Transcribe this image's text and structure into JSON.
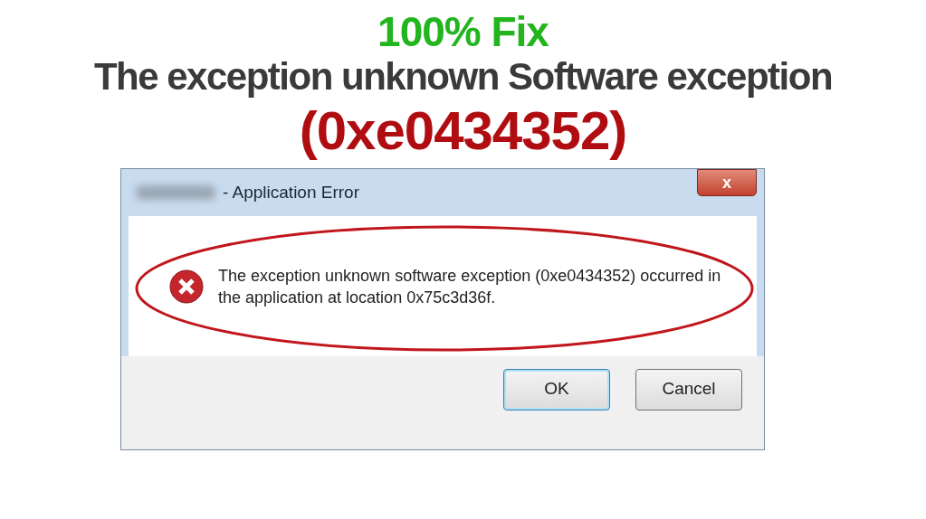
{
  "headline": {
    "badge": "100% Fix",
    "title": "The exception unknown Software exception",
    "code": "(0xe0434352)"
  },
  "dialog": {
    "title": "- Application Error",
    "close": "x",
    "message": "The exception unknown software exception (0xe0434352) occurred in the application at location 0x75c3d36f.",
    "buttons": [
      {
        "label": "OK",
        "focused": true
      },
      {
        "label": "Cancel",
        "focused": false
      }
    ]
  }
}
